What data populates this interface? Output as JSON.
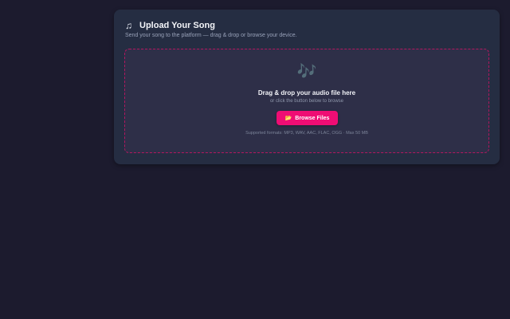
{
  "upload_card": {
    "title_icon": "♫",
    "title_icon_name": "music-note-icon",
    "title": "Upload Your Song",
    "subtitle": "Send your song to the platform — drag & drop or browse your device."
  },
  "dropzone": {
    "icon": "🎶",
    "icon_name": "music-notes-icon",
    "heading": "Drag & drop your audio file here",
    "hint": "or click the button below to browse",
    "button_icon": "📂",
    "button_icon_name": "folder-icon",
    "button_label": "Browse Files",
    "formats_note": "Supported formats: MP3, WAV, AAC, FLAC, OGG · Max 50 MB"
  },
  "colors": {
    "page_background": "#1c1b2e",
    "card_background": "#252d42",
    "dropzone_background": "#2e2f48",
    "dropzone_border": "#b3175f",
    "accent": "#ef0d74"
  }
}
